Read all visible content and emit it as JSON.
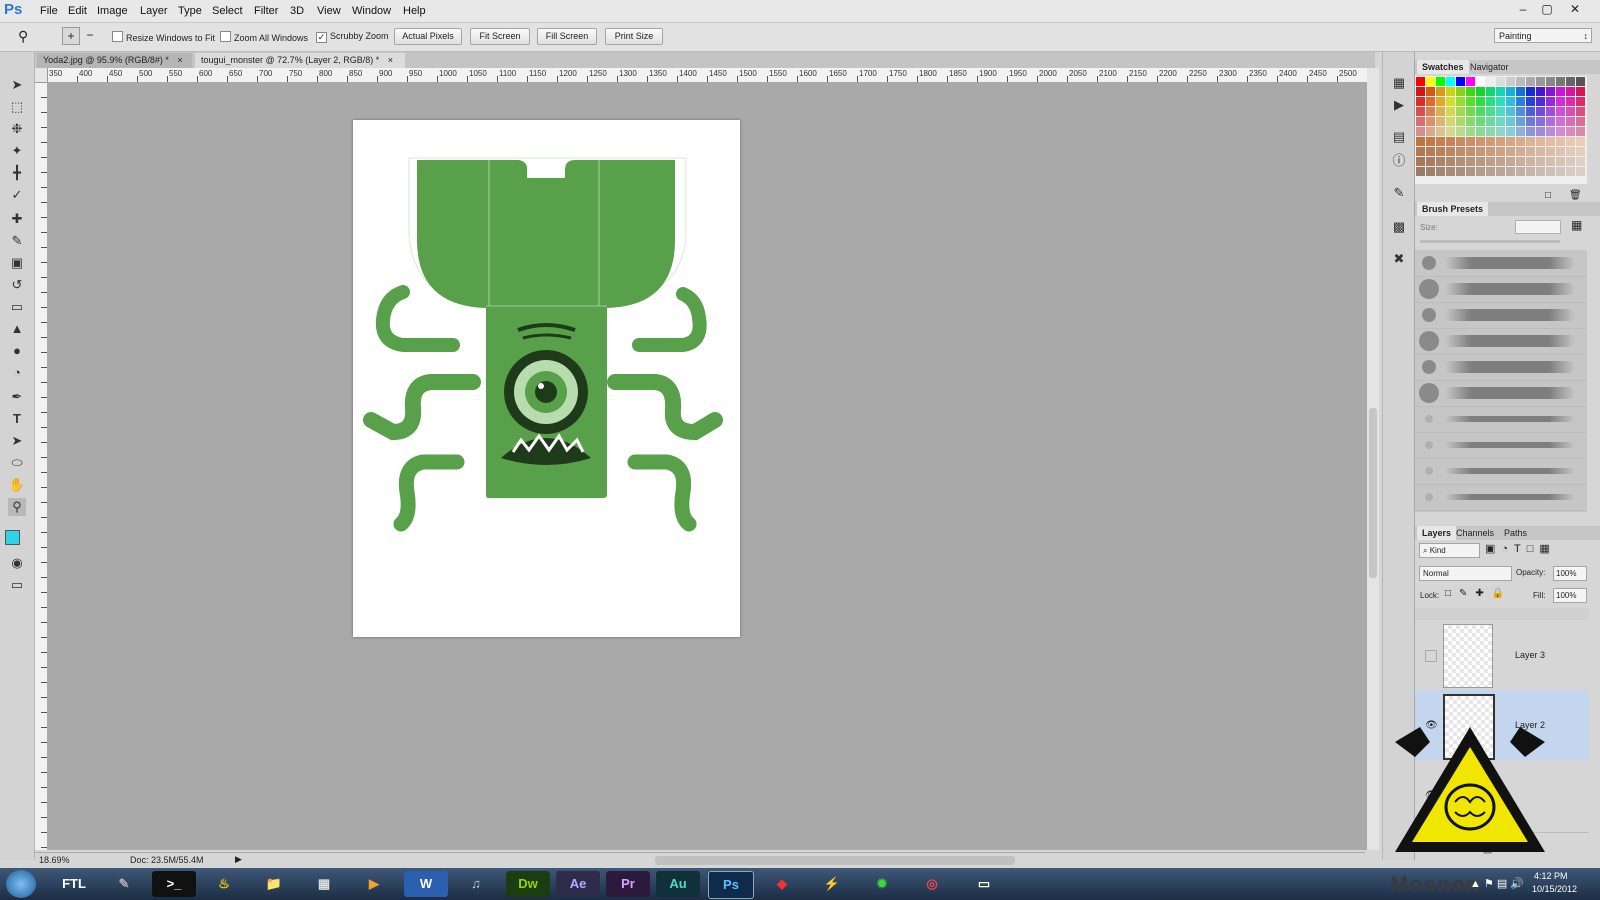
{
  "app": {
    "logo": "Ps"
  },
  "menu": [
    "File",
    "Edit",
    "Image",
    "Layer",
    "Type",
    "Select",
    "Filter",
    "3D",
    "View",
    "Window",
    "Help"
  ],
  "window_controls": [
    "–",
    "▢",
    "✕"
  ],
  "options": {
    "resize_windows": "Resize Windows to Fit",
    "zoom_all": "Zoom All Windows",
    "scrubby_zoom": "Scrubby Zoom",
    "scrubby_checked": "✓",
    "actual_pixels": "Actual Pixels",
    "fit_screen": "Fit Screen",
    "fill_screen": "Fill Screen",
    "print_size": "Print Size",
    "workspace": "Painting"
  },
  "tabs": [
    {
      "label": "Yoda2.jpg @ 95.9% (RGB/8#) *",
      "close": "×"
    },
    {
      "label": "tougui_monster @ 72.7% (Layer 2, RGB/8) *",
      "close": "×"
    }
  ],
  "ruler_labels": [
    "350",
    "400",
    "450",
    "500",
    "550",
    "600",
    "650",
    "700",
    "750",
    "800",
    "850",
    "900",
    "950",
    "1000",
    "1050",
    "1100",
    "1150",
    "1200",
    "1250",
    "1300",
    "1350",
    "1400",
    "1450",
    "1500",
    "1550",
    "1600",
    "1650",
    "1700",
    "1750",
    "1800",
    "1850",
    "1900",
    "1950",
    "2000",
    "2050",
    "2100",
    "2150",
    "2200",
    "2250",
    "2300",
    "2350",
    "2400",
    "2450",
    "2500"
  ],
  "status": {
    "zoom": "18.69%",
    "doc": "Doc: 23.5M/55.4M"
  },
  "panels": {
    "swatches_tab": "Swatches",
    "navigator_tab": "Navigator",
    "brush_presets_tab": "Brush Presets",
    "size_label": "Size:",
    "layers_tab": "Layers",
    "channels_tab": "Channels",
    "paths_tab": "Paths",
    "kind_label": "⌕ Kind",
    "blend_mode": "Normal",
    "opacity_label": "Opacity:",
    "opacity_value": "100%",
    "lock_label": "Lock:",
    "fill_label": "Fill:",
    "fill_value": "100%",
    "layers": [
      "Layer 3",
      "Layer 2"
    ]
  },
  "taskbar": {
    "apps": [
      "FTL",
      "",
      "",
      "",
      "",
      "",
      "",
      "W",
      "",
      "Dw",
      "Ae",
      "Pr",
      "Au",
      "Ps",
      "",
      "",
      "",
      "",
      ""
    ],
    "time": "4:12 PM",
    "date": "10/15/2012",
    "watermark": "Mosnon"
  },
  "colors": {
    "monster_green": "#58a04a",
    "dark": "#1f3a1a",
    "foreground": "#2fd3e8"
  }
}
